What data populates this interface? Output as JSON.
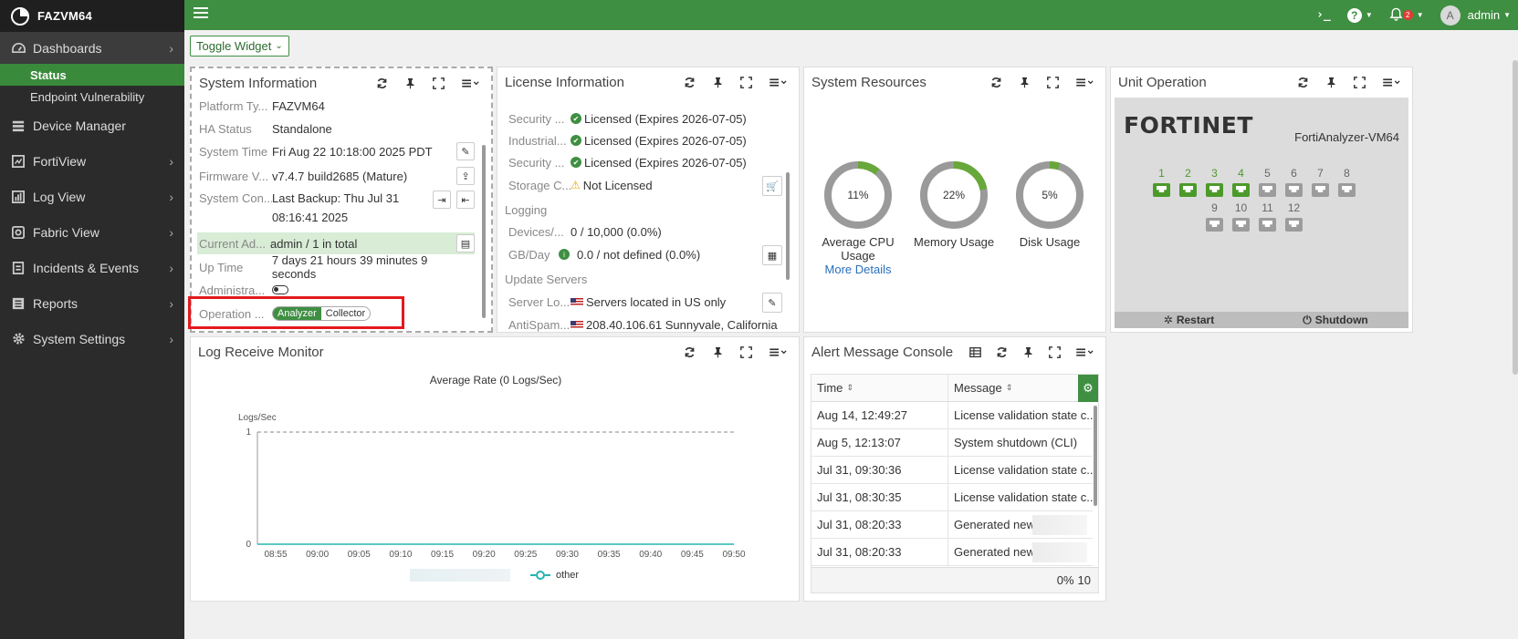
{
  "brand": {
    "name": "FAZVM64"
  },
  "sidebar": {
    "items": [
      {
        "label": "Dashboards",
        "icon": "dashboard-icon"
      },
      {
        "label": "Device Manager",
        "icon": "device-manager-icon"
      },
      {
        "label": "FortiView",
        "icon": "fortiview-icon"
      },
      {
        "label": "Log View",
        "icon": "log-view-icon"
      },
      {
        "label": "Fabric View",
        "icon": "fabric-view-icon"
      },
      {
        "label": "Incidents & Events",
        "icon": "incidents-icon"
      },
      {
        "label": "Reports",
        "icon": "reports-icon"
      },
      {
        "label": "System Settings",
        "icon": "settings-icon"
      }
    ],
    "subitems": [
      {
        "label": "Status",
        "active": true
      },
      {
        "label": "Endpoint Vulnerability",
        "active": false
      }
    ]
  },
  "topbar": {
    "notification_count": "2",
    "user": "admin",
    "avatar_letter": "A",
    "accent": "#3f8f42"
  },
  "toggle_widget": {
    "label": "Toggle Widget"
  },
  "system_info": {
    "title": "System Information",
    "rows": [
      {
        "label": "Platform Ty...",
        "value": "FAZVM64"
      },
      {
        "label": "HA Status",
        "value": "Standalone"
      },
      {
        "label": "System Time",
        "value": "Fri Aug 22 10:18:00 2025 PDT"
      },
      {
        "label": "Firmware V...",
        "value": "v7.4.7 build2685 (Mature)"
      },
      {
        "label": "System Con...",
        "value": "Last Backup: Thu Jul 31",
        "value2": "08:16:41 2025"
      },
      {
        "label": "Current Ad...",
        "value": "admin / 1 in total"
      },
      {
        "label": "Up Time",
        "value": "7 days 21 hours 39 minutes 9 seconds"
      },
      {
        "label": "Administra..."
      },
      {
        "label": "Operation ...",
        "mode_on": "Analyzer",
        "mode_off": "Collector"
      }
    ]
  },
  "license_info": {
    "title": "License Information",
    "licenses": [
      {
        "label": "Security ...",
        "value": "Licensed (Expires 2026-07-05)"
      },
      {
        "label": "Industrial...",
        "value": "Licensed (Expires 2026-07-05)"
      },
      {
        "label": "Security ...",
        "value": "Licensed (Expires 2026-07-05)"
      },
      {
        "label": "Storage C...",
        "value": "Not Licensed"
      }
    ],
    "logging_header": "Logging",
    "logging": [
      {
        "label": "Devices/...",
        "value": "0 / 10,000 (0.0%)"
      },
      {
        "label": "GB/Day",
        "value": "0.0 / not defined (0.0%)"
      }
    ],
    "update_header": "Update Servers",
    "update": [
      {
        "label": "Server Lo...",
        "value": "Servers located in US only"
      },
      {
        "label": "AntiSpam...",
        "value": "208.40.106.61 Sunnyvale, California"
      }
    ]
  },
  "system_resources": {
    "title": "System Resources",
    "gauges": [
      {
        "label": "Average CPU Usage",
        "percent": 11,
        "text": "11%"
      },
      {
        "label": "Memory Usage",
        "percent": 22,
        "text": "22%"
      },
      {
        "label": "Disk Usage",
        "percent": 5,
        "text": "5%"
      }
    ],
    "more_details": "More Details"
  },
  "unit_operation": {
    "title": "Unit Operation",
    "brand": "FORTINET",
    "model": "FortiAnalyzer-VM64",
    "ports_top": [
      {
        "n": "1",
        "on": true
      },
      {
        "n": "2",
        "on": true
      },
      {
        "n": "3",
        "on": true
      },
      {
        "n": "4",
        "on": true
      },
      {
        "n": "5",
        "on": false
      },
      {
        "n": "6",
        "on": false
      },
      {
        "n": "7",
        "on": false
      },
      {
        "n": "8",
        "on": false
      }
    ],
    "ports_bottom": [
      {
        "n": "9",
        "on": false
      },
      {
        "n": "10",
        "on": false
      },
      {
        "n": "11",
        "on": false
      },
      {
        "n": "12",
        "on": false
      }
    ],
    "restart_label": "Restart",
    "shutdown_label": "Shutdown"
  },
  "log_monitor": {
    "title": "Log Receive Monitor",
    "legend_other": "other"
  },
  "chart_data": {
    "type": "line",
    "title": "Average Rate (0 Logs/Sec)",
    "ylabel": "Logs/Sec",
    "xlabel": "",
    "ylim": [
      0,
      1
    ],
    "yticks": [
      "1",
      "0"
    ],
    "x": [
      "08:55",
      "09:00",
      "09:05",
      "09:10",
      "09:15",
      "09:20",
      "09:25",
      "09:30",
      "09:35",
      "09:40",
      "09:45",
      "09:50"
    ],
    "series": [
      {
        "name": "other",
        "color": "#26b5b0",
        "values": [
          0,
          0,
          0,
          0,
          0,
          0,
          0,
          0,
          0,
          0,
          0,
          0
        ]
      }
    ],
    "grid": false,
    "legend": "bottom"
  },
  "alert_console": {
    "title": "Alert Message Console",
    "col_time": "Time",
    "col_message": "Message",
    "rows": [
      {
        "time": "Aug 14, 12:49:27",
        "message": "License validation state c..."
      },
      {
        "time": "Aug 5, 12:13:07",
        "message": "System shutdown (CLI)"
      },
      {
        "time": "Jul 31, 09:30:36",
        "message": "License validation state c..."
      },
      {
        "time": "Jul 31, 08:30:35",
        "message": "License validation state c..."
      },
      {
        "time": "Jul 31, 08:20:33",
        "message": "Generated new"
      },
      {
        "time": "Jul 31, 08:20:33",
        "message": "Generated new"
      }
    ],
    "footer_percent": "0%",
    "footer_count": "10"
  }
}
